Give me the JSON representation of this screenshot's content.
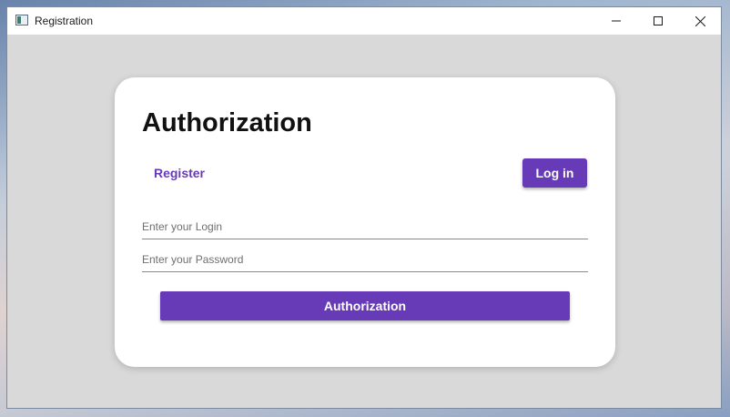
{
  "window": {
    "title": "Registration",
    "controls": {
      "minimize": "minimize-icon",
      "maximize": "maximize-icon",
      "close": "close-icon"
    }
  },
  "card": {
    "title": "Authorization",
    "register_label": "Register",
    "login_label": "Log in",
    "login_field": {
      "placeholder": "Enter your Login",
      "value": ""
    },
    "password_field": {
      "placeholder": "Enter your Password",
      "value": ""
    },
    "submit_label": "Authorization"
  },
  "colors": {
    "accent": "#673ab7",
    "client_background": "#d9d9d9",
    "card_background": "#ffffff"
  }
}
